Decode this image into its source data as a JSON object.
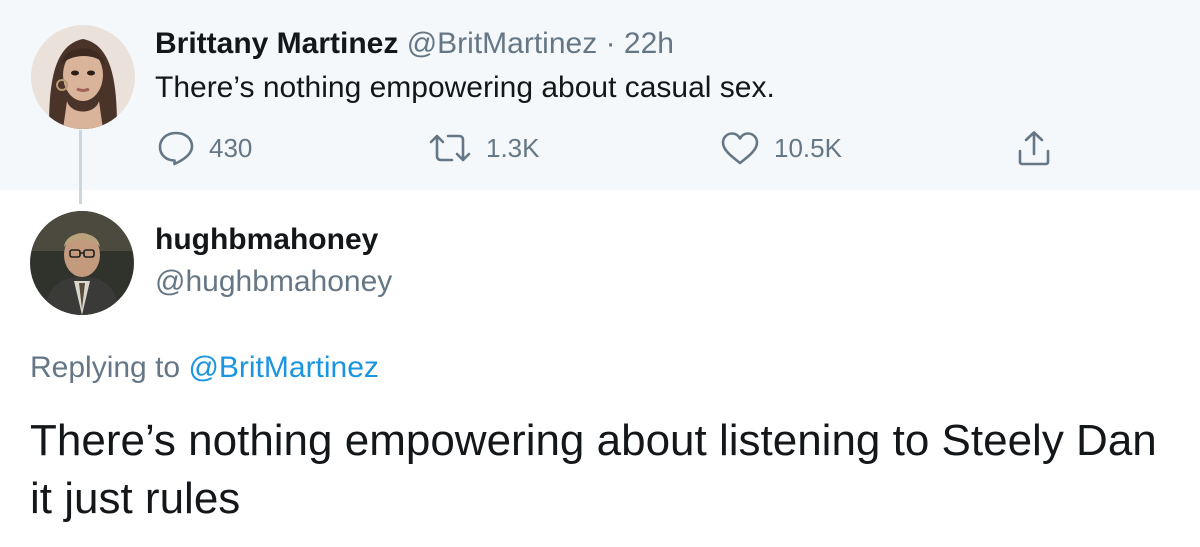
{
  "parent_tweet": {
    "name": "Brittany Martinez",
    "handle": "@BritMartinez",
    "separator": "·",
    "time": "22h",
    "text": "There’s nothing empowering about casual sex.",
    "actions": {
      "reply_count": "430",
      "retweet_count": "1.3K",
      "like_count": "10.5K"
    }
  },
  "reply_tweet": {
    "name": "hughbmahoney",
    "handle": "@hughbmahoney",
    "replying_prefix": "Replying to ",
    "replying_to": "@BritMartinez",
    "text": "There’s nothing empowering about listening to Steely Dan it just rules"
  },
  "icons": {
    "reply": "comment-bubble-icon",
    "retweet": "retweet-arrows-icon",
    "like": "heart-outline-icon",
    "share": "share-upload-icon"
  },
  "colors": {
    "parent_background": "#f5f8fa",
    "primary_text": "#14171a",
    "secondary_text": "#657786",
    "link": "#1b95e0",
    "thread_line": "#ccd6dd"
  }
}
